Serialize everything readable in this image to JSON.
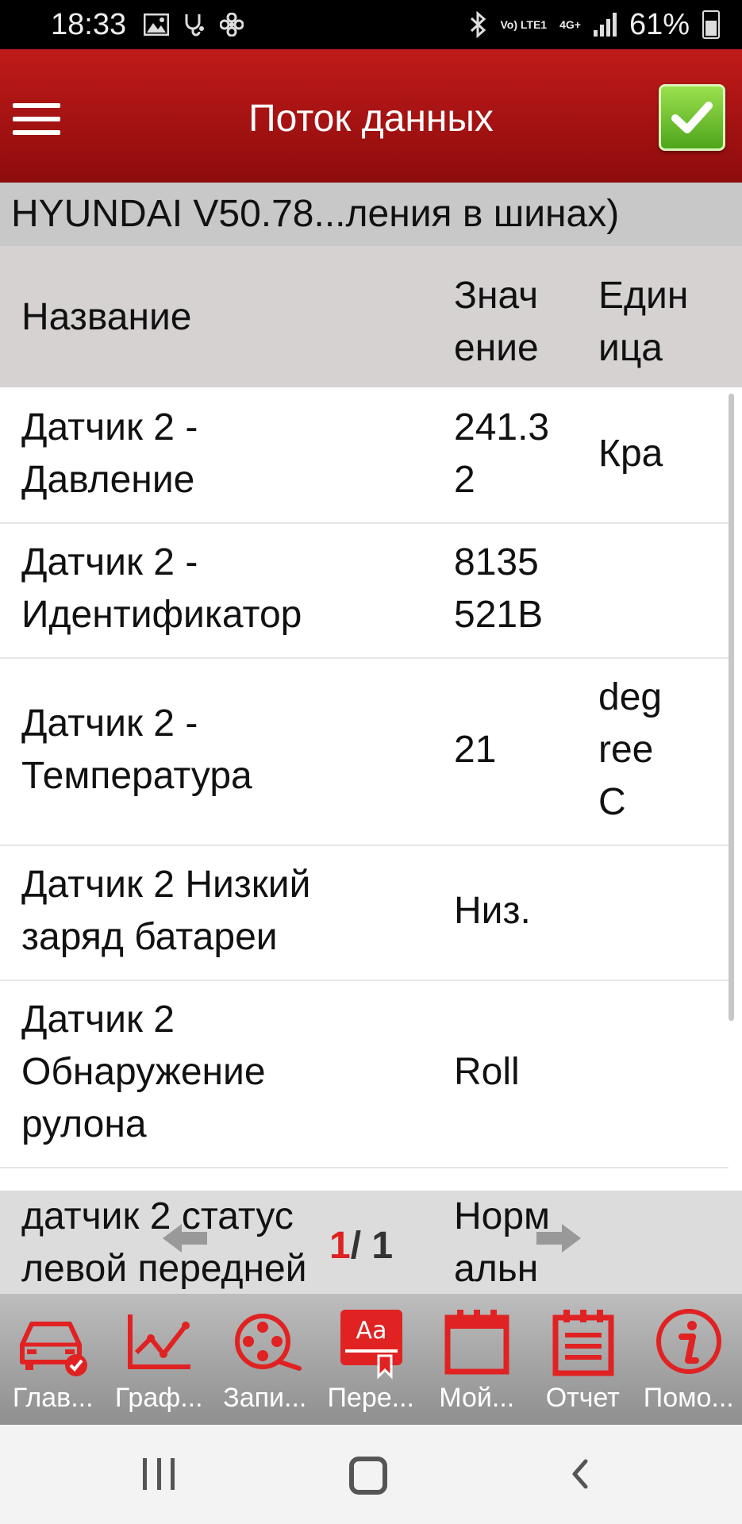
{
  "status_bar": {
    "time": "18:33",
    "network": "Vo) LTE1",
    "network_type": "4G+",
    "battery": "61%"
  },
  "header": {
    "title": "Поток данных"
  },
  "banner": {
    "text": "HYUNDAI V50.78...ления в шинах)"
  },
  "table": {
    "columns": {
      "name": "Название",
      "value_line1": "Знач",
      "value_line2": "ение",
      "unit_line1": "Един",
      "unit_line2": "ица"
    },
    "rows": [
      {
        "name1": "Датчик 2 -",
        "name2": "Давление",
        "name3": "",
        "val1": "241.3",
        "val2": "2",
        "unit1": "Кра",
        "unit2": "",
        "unit3": ""
      },
      {
        "name1": "Датчик 2 -",
        "name2": "Идентификатор",
        "name3": "",
        "val1": "8135",
        "val2": "521B",
        "unit1": "",
        "unit2": "",
        "unit3": ""
      },
      {
        "name1": "Датчик 2 -",
        "name2": "Температура",
        "name3": "",
        "val1": "21",
        "val2": "",
        "unit1": "deg",
        "unit2": "ree",
        "unit3": "C"
      },
      {
        "name1": "Датчик 2 Низкий",
        "name2": "заряд батареи",
        "name3": "",
        "val1": "Низ.",
        "val2": "",
        "unit1": "",
        "unit2": "",
        "unit3": ""
      },
      {
        "name1": "Датчик 2",
        "name2": "Обнаружение",
        "name3": "рулона",
        "val1": "Roll",
        "val2": "",
        "unit1": "",
        "unit2": "",
        "unit3": ""
      }
    ],
    "last_row": {
      "name1": "датчик 2 статус",
      "name2": "левой передней",
      "val1": "Норм",
      "val2": "альн"
    }
  },
  "pager": {
    "current": "1",
    "separator": "/ ",
    "total": "1"
  },
  "toolbar": [
    {
      "label": "Глав...",
      "icon": "car-check-icon"
    },
    {
      "label": "Граф...",
      "icon": "graph-icon"
    },
    {
      "label": "Запи...",
      "icon": "film-reel-icon"
    },
    {
      "label": "Пере...",
      "icon": "translate-icon"
    },
    {
      "label": "Мой...",
      "icon": "calendar-icon"
    },
    {
      "label": "Отчет",
      "icon": "report-icon"
    },
    {
      "label": "Помо...",
      "icon": "info-icon"
    }
  ],
  "colors": {
    "header_red": "#b01414",
    "icon_red": "#e02222",
    "accept_green": "#6cc12e"
  }
}
